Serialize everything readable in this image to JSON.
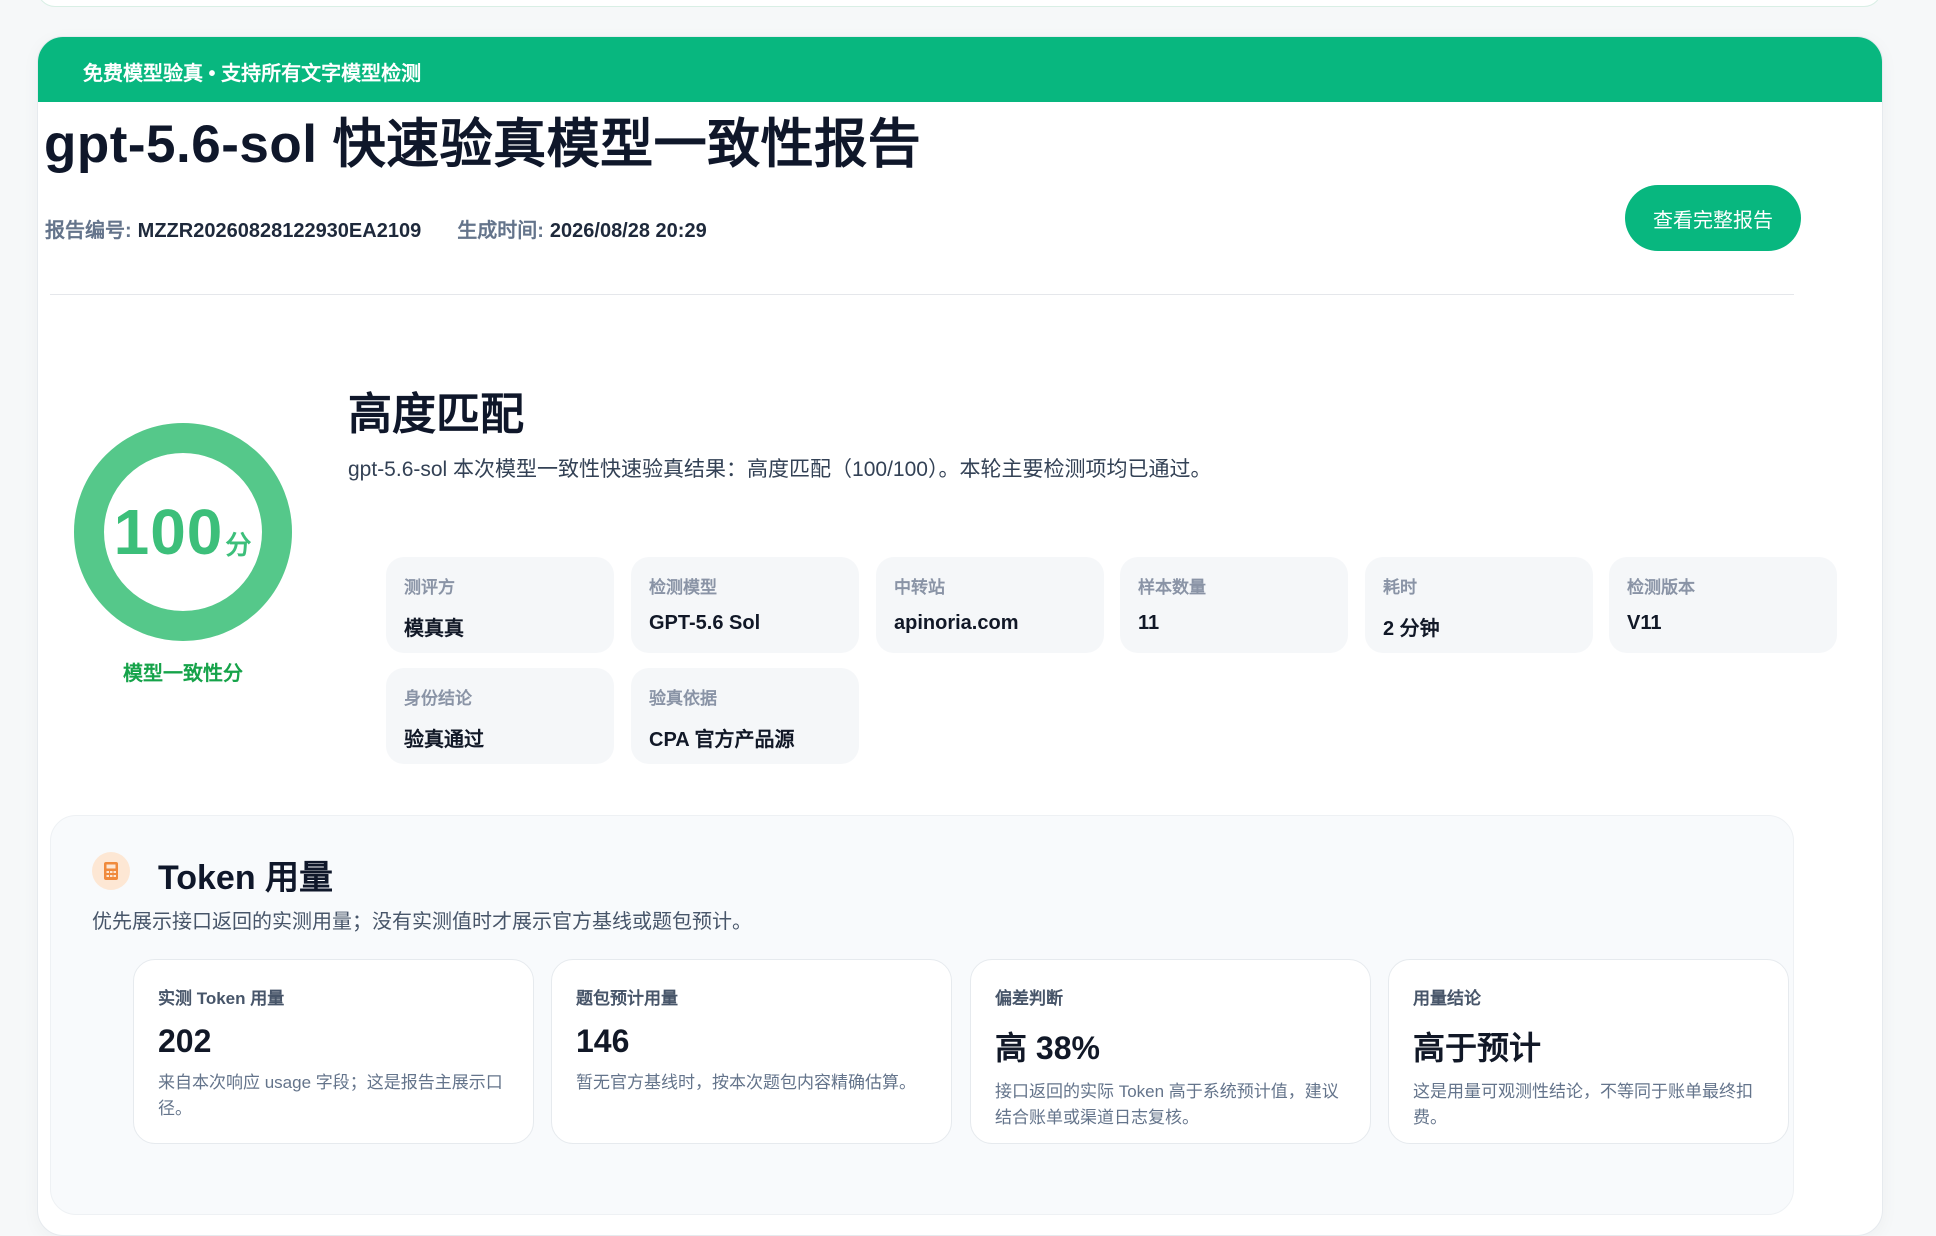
{
  "banner": {
    "text": "免费模型验真 • 支持所有文字模型检测"
  },
  "report": {
    "title": "gpt-5.6-sol 快速验真模型一致性报告",
    "id_label": "报告编号:",
    "id_value": "MZZR20260828122930EA2109",
    "time_label": "生成时间:",
    "time_value": "2026/08/28 20:29",
    "full_report_button": "查看完整报告"
  },
  "score": {
    "value": "100",
    "unit": "分",
    "caption": "模型一致性分",
    "fraction": 1.0,
    "ring_color": "#55c88a"
  },
  "verdict": {
    "title": "高度匹配",
    "description": "gpt-5.6-sol 本次模型一致性快速验真结果：高度匹配（100/100）。本轮主要检测项均已通过。"
  },
  "info_items": [
    {
      "label": "测评方",
      "value": "模真真"
    },
    {
      "label": "检测模型",
      "value": "GPT-5.6 Sol"
    },
    {
      "label": "中转站",
      "value": "apinoria.com"
    },
    {
      "label": "样本数量",
      "value": "11"
    },
    {
      "label": "耗时",
      "value": "2 分钟"
    },
    {
      "label": "检测版本",
      "value": "V11"
    },
    {
      "label": "身份结论",
      "value": "验真通过"
    },
    {
      "label": "验真依据",
      "value": "CPA 官方产品源"
    }
  ],
  "token": {
    "icon": "calculator-icon",
    "title": "Token 用量",
    "subtitle": "优先展示接口返回的实测用量；没有实测值时才展示官方基线或题包预计。",
    "cards": [
      {
        "label": "实测 Token 用量",
        "value": "202",
        "note": "来自本次响应 usage 字段；这是报告主展示口径。"
      },
      {
        "label": "题包预计用量",
        "value": "146",
        "note": "暂无官方基线时，按本次题包内容精确估算。"
      },
      {
        "label": "偏差判断",
        "value": "高 38%",
        "note": "接口返回的实际 Token 高于系统预计值，建议结合账单或渠道日志复核。"
      },
      {
        "label": "用量结论",
        "value": "高于预计",
        "note": "这是用量可观测性结论，不等同于账单最终扣费。"
      }
    ]
  },
  "colors": {
    "brand": "#08b77f",
    "score": "#3cbf7a"
  }
}
